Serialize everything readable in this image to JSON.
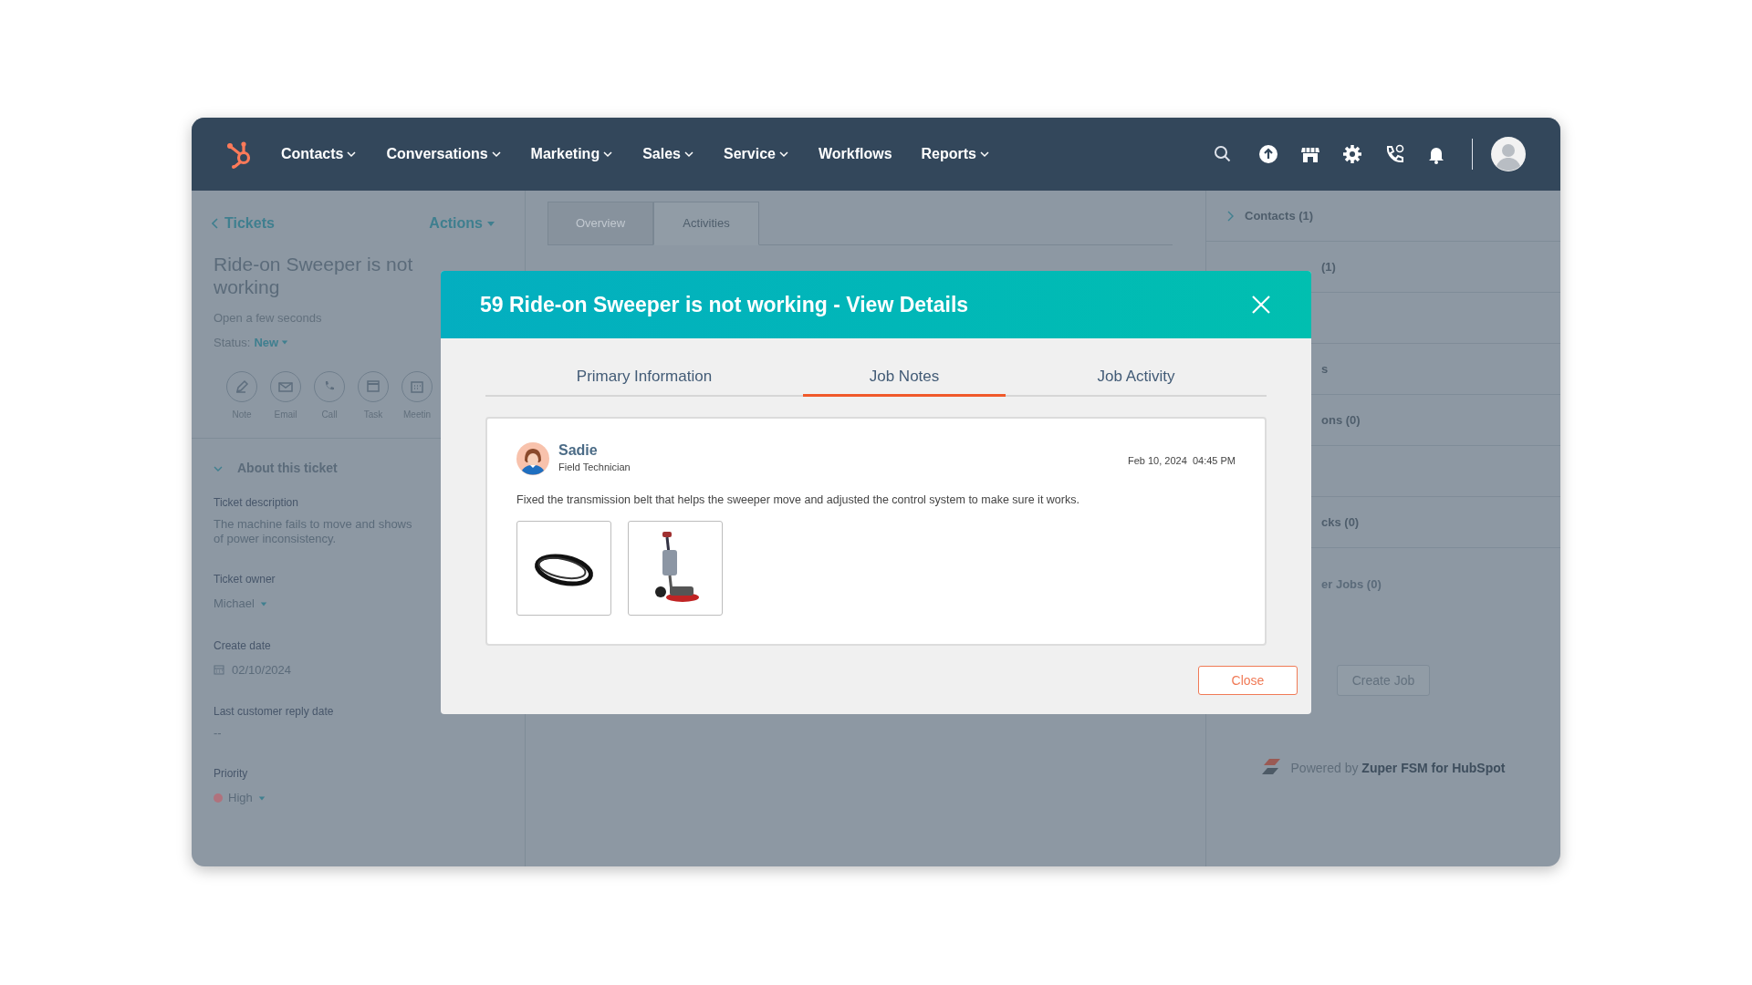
{
  "nav": {
    "items": [
      {
        "label": "Contacts",
        "has_menu": true
      },
      {
        "label": "Conversations",
        "has_menu": true
      },
      {
        "label": "Marketing",
        "has_menu": true
      },
      {
        "label": "Sales",
        "has_menu": true
      },
      {
        "label": "Service",
        "has_menu": true
      },
      {
        "label": "Workflows",
        "has_menu": false
      },
      {
        "label": "Reports",
        "has_menu": true
      }
    ]
  },
  "left_panel": {
    "back_link": "Tickets",
    "actions": "Actions",
    "title": "Ride-on Sweeper is not working",
    "subtitle": "Open a few seconds",
    "status_label": "Status:",
    "status_value": "New",
    "activity_buttons": [
      {
        "kind": "note",
        "label": "Note"
      },
      {
        "kind": "email",
        "label": "Email"
      },
      {
        "kind": "call",
        "label": "Call"
      },
      {
        "kind": "task",
        "label": "Task"
      },
      {
        "kind": "meeting",
        "label": "Meetin"
      }
    ],
    "section": {
      "title": "About this ticket",
      "expanded": true
    },
    "fields": [
      {
        "kind": "text",
        "label": "Ticket description",
        "lines": [
          "The machine fails to move and shows",
          "of power inconsistency."
        ]
      },
      {
        "kind": "select",
        "label": "Ticket owner",
        "value": "Michael"
      },
      {
        "kind": "date",
        "label": "Create date",
        "value": "02/10/2024"
      },
      {
        "kind": "text",
        "label": "Last customer reply date",
        "lines": [
          "--"
        ]
      },
      {
        "kind": "priority",
        "label": "Priority",
        "value": "High",
        "color": "#b0727d"
      }
    ]
  },
  "center_tabs": [
    {
      "label": "Overview",
      "selected": false
    },
    {
      "label": "Activities",
      "selected": true
    }
  ],
  "right_panel": {
    "cards": [
      {
        "kind": "full",
        "label": "Contacts (1)"
      },
      {
        "kind": "partial",
        "label": "(1)"
      },
      {
        "kind": "blank"
      },
      {
        "kind": "partial",
        "label": "s"
      },
      {
        "kind": "partial",
        "label": "ons (0)"
      },
      {
        "kind": "blank"
      },
      {
        "kind": "partial",
        "label": "cks (0)"
      }
    ],
    "jobs_heading": "er Jobs (0)",
    "create_button": "Create Job",
    "powered_by": "Powered by **Zuper FSM for HubSpot**"
  },
  "modal": {
    "title": "59 Ride-on Sweeper is not working - View Details",
    "tabs": [
      {
        "label": "Primary Information",
        "selected": false
      },
      {
        "label": "Job Notes",
        "selected": true
      },
      {
        "label": "Job Activity",
        "selected": false
      }
    ],
    "note": {
      "author": "Sadie",
      "role": "Field Technician",
      "timestamp": "Feb 10, 2024  04:45 PM",
      "text": "Fixed the transmission belt that helps the sweeper move and adjusted the control system to make sure it works.",
      "attachments": [
        {
          "kind": "belt"
        },
        {
          "kind": "machine"
        }
      ]
    },
    "close_button": "Close"
  }
}
